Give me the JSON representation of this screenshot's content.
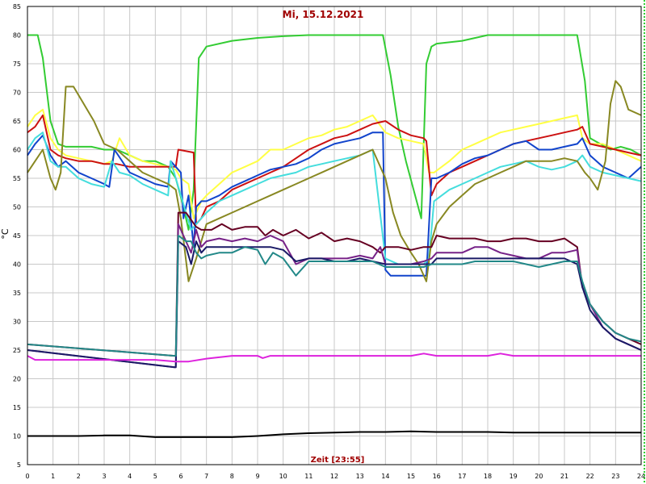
{
  "chart_data": {
    "type": "line",
    "title": "Mi, 15.12.2021",
    "xlabel": "Zeit [23:55]",
    "ylabel": "°C",
    "xlim": [
      0,
      24
    ],
    "ylim": [
      5,
      85
    ],
    "x_ticks": [
      0,
      1,
      2,
      3,
      4,
      5,
      6,
      7,
      8,
      9,
      10,
      11,
      12,
      13,
      14,
      15,
      16,
      17,
      18,
      19,
      20,
      21,
      22,
      23,
      24
    ],
    "y_ticks": [
      5,
      10,
      15,
      20,
      25,
      30,
      35,
      40,
      45,
      50,
      55,
      60,
      65,
      70,
      75,
      80,
      85
    ],
    "grid": true,
    "title_color": "#a00000",
    "xlabel_color": "#a00000",
    "series": [
      {
        "color": "#33cc33",
        "x": [
          0,
          0.4,
          0.6,
          0.9,
          1.2,
          1.5,
          2,
          2.5,
          3,
          3.5,
          4,
          4.5,
          5,
          5.5,
          5.8,
          6.1,
          6.3,
          6.5,
          6.7,
          7,
          8,
          9,
          10,
          11,
          12,
          13,
          13.9,
          14.2,
          14.5,
          14.8,
          15.1,
          15.4,
          15.6,
          15.8,
          16,
          17,
          18,
          19,
          20,
          21,
          21.5,
          21.8,
          22,
          22.4,
          22.8,
          23.2,
          23.6,
          24
        ],
        "y": [
          80,
          80,
          76,
          65,
          61,
          60.5,
          60.5,
          60.5,
          60,
          60,
          59,
          58,
          58,
          57,
          55,
          50,
          46,
          53,
          76,
          78,
          79,
          79.5,
          79.8,
          80,
          80,
          80,
          80,
          73,
          64,
          58,
          53,
          48,
          75,
          78,
          78.5,
          79,
          80,
          80,
          80,
          80,
          80,
          72,
          62,
          61,
          60,
          60.5,
          60,
          59
        ]
      },
      {
        "color": "#ffff44",
        "x": [
          0,
          0.3,
          0.6,
          0.9,
          1.2,
          1.5,
          2,
          2.5,
          3,
          3.3,
          3.6,
          4,
          4.5,
          5,
          5.5,
          5.8,
          6,
          6.3,
          6.5,
          6.8,
          7,
          7.5,
          8,
          8.5,
          9,
          9.5,
          10,
          10.5,
          11,
          11.5,
          12,
          12.5,
          13,
          13.5,
          14,
          14.5,
          15,
          15.5,
          15.7,
          15.9,
          16.2,
          16.5,
          17,
          17.5,
          18,
          18.5,
          19,
          19.5,
          20,
          20.5,
          21,
          21.5,
          21.7,
          22,
          22.5,
          23,
          23.5,
          24
        ],
        "y": [
          64,
          66,
          67,
          62,
          60,
          59,
          58.5,
          58,
          57.5,
          58,
          62,
          59,
          58,
          57.5,
          57,
          56.5,
          55,
          54,
          48,
          51,
          52,
          54,
          56,
          57,
          58,
          60,
          60,
          61,
          62,
          62.5,
          63.5,
          64,
          65,
          66,
          63,
          62,
          61.5,
          61,
          56,
          56,
          57,
          58,
          60,
          61,
          62,
          63,
          63.5,
          64,
          64.5,
          65,
          65.5,
          66,
          62,
          61,
          61,
          60,
          59,
          58
        ]
      },
      {
        "color": "#cc1111",
        "x": [
          0,
          0.3,
          0.6,
          0.9,
          1.2,
          1.5,
          2,
          2.5,
          3,
          3.5,
          4,
          4.5,
          5,
          5.5,
          5.8,
          5.9,
          6.5,
          6.6,
          6.8,
          7,
          7.5,
          8,
          8.5,
          9,
          9.5,
          10,
          10.5,
          11,
          11.5,
          12,
          12.5,
          13,
          13.5,
          14,
          14.5,
          15,
          15.5,
          15.6,
          15.8,
          16,
          16.5,
          17,
          17.5,
          18,
          18.5,
          19,
          19.5,
          20,
          20.5,
          21,
          21.5,
          21.7,
          22,
          22.5,
          23,
          23.5,
          24
        ],
        "y": [
          63,
          64,
          66,
          60,
          59,
          58.5,
          58,
          58,
          57.5,
          57.5,
          57,
          57,
          57,
          57,
          57,
          60,
          59.5,
          47,
          48,
          50,
          51,
          53,
          54,
          55,
          56,
          57,
          58.5,
          60,
          61,
          62,
          62.5,
          63.5,
          64.5,
          65,
          63.5,
          62.5,
          62,
          61.5,
          52,
          54,
          56,
          57,
          58,
          59,
          60,
          61,
          61.5,
          62,
          62.5,
          63,
          63.5,
          64,
          61,
          60.5,
          60,
          59.5,
          59
        ]
      },
      {
        "color": "#1144cc",
        "x": [
          0,
          0.3,
          0.6,
          0.9,
          1.2,
          1.5,
          2,
          2.5,
          3,
          3.2,
          3.4,
          3.7,
          4,
          4.5,
          5,
          5.5,
          5.6,
          5.8,
          6,
          6.1,
          6.3,
          6.5,
          6.6,
          6.8,
          7,
          7.5,
          8,
          8.5,
          9,
          9.5,
          10,
          10.5,
          11,
          11.5,
          12,
          12.5,
          13,
          13.5,
          13.9,
          14,
          14.2,
          14.5,
          15,
          15.4,
          15.6,
          15.8,
          16,
          16.5,
          17,
          17.5,
          18,
          18.5,
          19,
          19.5,
          20,
          20.5,
          21,
          21.5,
          21.7,
          22,
          22.5,
          23,
          23.5,
          24
        ],
        "y": [
          59,
          61,
          62.5,
          59,
          57,
          58,
          56,
          55,
          54,
          53.5,
          60,
          58,
          56,
          55,
          54,
          53.5,
          58,
          57,
          56,
          48,
          52,
          43,
          50,
          51,
          51,
          52,
          53.5,
          54.5,
          55.5,
          56.5,
          57,
          57.5,
          58.5,
          60,
          61,
          61.5,
          62,
          63,
          63,
          39,
          38,
          38,
          38,
          38,
          38,
          55,
          55,
          56,
          57.5,
          58.5,
          59,
          60,
          61,
          61.5,
          60,
          60,
          60.5,
          61,
          62,
          59,
          57,
          56,
          55,
          57
        ]
      },
      {
        "color": "#44dddd",
        "x": [
          0,
          0.3,
          0.6,
          0.9,
          1.2,
          1.5,
          2,
          2.5,
          3,
          3.3,
          3.6,
          4,
          4.5,
          5,
          5.5,
          5.6,
          5.8,
          6,
          6.2,
          6.4,
          6.6,
          6.8,
          7,
          7.5,
          8,
          8.5,
          9,
          9.5,
          10,
          10.5,
          11,
          11.5,
          12,
          12.5,
          13,
          13.5,
          14,
          14.5,
          15,
          15.5,
          15.7,
          15.9,
          16.2,
          16.5,
          17,
          17.5,
          18,
          18.5,
          19,
          19.5,
          20,
          20.5,
          21,
          21.5,
          21.7,
          22,
          22.5,
          23,
          23.5,
          24
        ],
        "y": [
          60,
          62,
          63,
          58,
          57,
          57,
          55,
          54,
          53.5,
          58,
          56,
          55.5,
          54,
          53,
          52,
          58,
          55,
          52,
          49,
          46,
          47,
          48,
          49,
          51,
          52,
          53,
          54,
          55,
          55.5,
          56,
          57,
          57.5,
          58,
          58.5,
          59,
          60,
          41,
          40,
          40,
          40,
          41,
          51,
          52,
          53,
          54,
          55,
          56,
          57,
          57.5,
          58,
          57,
          56.5,
          57,
          58,
          59,
          57,
          56,
          55.5,
          55,
          54.5
        ]
      },
      {
        "color": "#888822",
        "x": [
          0,
          0.3,
          0.6,
          0.9,
          1.1,
          1.3,
          1.5,
          1.8,
          2.2,
          2.6,
          3,
          3.5,
          4,
          4.5,
          5,
          5.5,
          5.8,
          6,
          6.3,
          6.6,
          6.8,
          7,
          7.5,
          8,
          8.5,
          9,
          9.5,
          10,
          10.5,
          11,
          11.5,
          12,
          12.5,
          13,
          13.5,
          14,
          14.3,
          14.6,
          15,
          15.3,
          15.6,
          15.8,
          16,
          16.5,
          17,
          17.5,
          18,
          18.5,
          19,
          19.5,
          20,
          20.5,
          21,
          21.5,
          21.8,
          22,
          22.3,
          22.6,
          22.8,
          23,
          23.2,
          23.5,
          24
        ],
        "y": [
          56,
          58,
          60,
          55,
          53,
          56,
          71,
          71,
          68,
          65,
          61,
          60,
          58,
          56,
          55,
          54,
          53,
          48,
          37,
          41,
          44,
          47,
          48,
          49,
          50,
          51,
          52,
          53,
          54,
          55,
          56,
          57,
          58,
          59,
          60,
          55,
          49,
          45,
          42,
          40,
          37,
          44,
          47,
          50,
          52,
          54,
          55,
          56,
          57,
          58,
          58,
          58,
          58.5,
          58,
          56,
          55,
          53,
          58,
          68,
          72,
          71,
          67,
          66
        ]
      },
      {
        "color": "#660022",
        "x": [
          0,
          5.75,
          5.8,
          5.9,
          6.2,
          6.6,
          6.8,
          7.2,
          7.6,
          8,
          8.5,
          9,
          9.3,
          9.6,
          10,
          10.5,
          11,
          11.5,
          12,
          12.5,
          13,
          13.5,
          13.8,
          14,
          14.5,
          15,
          15.5,
          15.8,
          16,
          16.5,
          17,
          17.5,
          18,
          18.5,
          19,
          19.5,
          20,
          20.5,
          21,
          21.5,
          21.7,
          22,
          22.5,
          23,
          23.5,
          24
        ],
        "y": [
          26,
          24,
          24,
          49,
          49,
          46.5,
          46,
          46,
          47,
          46,
          46.5,
          46.5,
          45,
          46,
          45,
          46,
          44.5,
          45.5,
          44,
          44.5,
          44,
          43,
          42,
          43,
          43,
          42.5,
          43,
          43,
          45,
          44.5,
          44.5,
          44.5,
          44,
          44,
          44.5,
          44.5,
          44,
          44,
          44.5,
          43,
          36,
          33,
          30,
          28,
          27,
          26
        ]
      },
      {
        "color": "#772288",
        "x": [
          0,
          5.75,
          5.8,
          5.9,
          6.2,
          6.4,
          6.6,
          6.8,
          7,
          7.5,
          8,
          8.5,
          9,
          9.5,
          10,
          10.5,
          11,
          11.5,
          12,
          12.5,
          13,
          13.5,
          13.8,
          14,
          14.5,
          15,
          15.5,
          15.8,
          16,
          16.5,
          17,
          17.5,
          18,
          18.5,
          19,
          19.5,
          20,
          20.5,
          21,
          21.5,
          21.7,
          22,
          22.5,
          23,
          23.5,
          24
        ],
        "y": [
          25,
          22,
          22,
          47,
          44,
          42,
          46,
          43,
          44,
          44.5,
          44,
          44.5,
          44,
          45,
          44,
          40,
          41,
          41,
          41,
          41,
          41.5,
          41,
          43,
          40,
          40,
          40,
          40.5,
          41,
          42,
          42,
          42,
          43,
          43,
          42,
          41.5,
          41,
          41,
          42,
          42,
          42.5,
          36,
          33,
          29,
          27,
          26,
          25
        ]
      },
      {
        "color": "#1a1a66",
        "x": [
          0,
          5.75,
          5.8,
          5.9,
          6.2,
          6.4,
          6.6,
          6.8,
          7,
          7.5,
          8,
          8.5,
          9,
          9.5,
          10,
          10.5,
          11,
          11.5,
          12,
          12.5,
          13,
          13.5,
          14,
          14.5,
          15,
          15.5,
          15.8,
          16,
          16.5,
          17,
          17.5,
          18,
          18.5,
          19,
          19.5,
          20,
          20.5,
          21,
          21.5,
          21.7,
          22,
          22.5,
          23,
          23.5,
          24
        ],
        "y": [
          25,
          22,
          22,
          44,
          43,
          40,
          44,
          42,
          43,
          43,
          43,
          43,
          43,
          43,
          42.5,
          40.5,
          41,
          41,
          40.5,
          40.5,
          41,
          40.5,
          40,
          40,
          40,
          40,
          40,
          41,
          41,
          41,
          41,
          41,
          41,
          41,
          41,
          41,
          41,
          41,
          40,
          36,
          32,
          29,
          27,
          26,
          25
        ]
      },
      {
        "color": "#228888",
        "x": [
          0,
          5.75,
          5.8,
          5.9,
          6.2,
          6.4,
          6.6,
          6.8,
          7,
          7.5,
          8,
          8.5,
          9,
          9.3,
          9.6,
          10,
          10.5,
          11,
          11.5,
          12,
          12.5,
          13,
          13.5,
          14,
          14.5,
          15,
          15.5,
          15.8,
          16,
          16.5,
          17,
          17.5,
          18,
          18.5,
          19,
          19.5,
          20,
          20.5,
          21,
          21.5,
          21.7,
          22,
          22.5,
          23,
          23.5,
          24
        ],
        "y": [
          26,
          24,
          24,
          45,
          44,
          44,
          42,
          41,
          41.5,
          42,
          42,
          43,
          42.5,
          40,
          42,
          41,
          38,
          40.5,
          40.5,
          40.5,
          40.5,
          40.5,
          40.5,
          39.5,
          39.5,
          39.5,
          39.5,
          40,
          40,
          40,
          40,
          40.5,
          40.5,
          40.5,
          40.5,
          40,
          39.5,
          40,
          40.5,
          40.5,
          37,
          33,
          30,
          28,
          27,
          26.5
        ]
      },
      {
        "color": "#dd22dd",
        "x": [
          0,
          0.3,
          1,
          2,
          3,
          4,
          5,
          5.8,
          6.3,
          7,
          8,
          9,
          9.2,
          9.5,
          10,
          11,
          12,
          13,
          14,
          15,
          15.5,
          16,
          17,
          18,
          18.5,
          19,
          20,
          21,
          22,
          23,
          24
        ],
        "y": [
          24,
          23.3,
          23.3,
          23.3,
          23.3,
          23.3,
          23.3,
          23,
          23,
          23.5,
          24,
          24,
          23.6,
          24,
          24,
          24,
          24,
          24,
          24,
          24,
          24.4,
          24,
          24,
          24,
          24.4,
          24,
          24,
          24,
          24,
          24,
          24
        ]
      },
      {
        "color": "#000000",
        "x": [
          0,
          1,
          2,
          3,
          4,
          5,
          6,
          7,
          8,
          9,
          10,
          11,
          12,
          13,
          14,
          15,
          16,
          17,
          18,
          19,
          20,
          21,
          22,
          23,
          24
        ],
        "y": [
          10,
          10,
          10,
          10.1,
          10.1,
          9.8,
          9.8,
          9.8,
          9.8,
          10,
          10.3,
          10.5,
          10.6,
          10.7,
          10.7,
          10.8,
          10.7,
          10.7,
          10.7,
          10.6,
          10.6,
          10.6,
          10.6,
          10.6,
          10.6
        ]
      }
    ]
  }
}
